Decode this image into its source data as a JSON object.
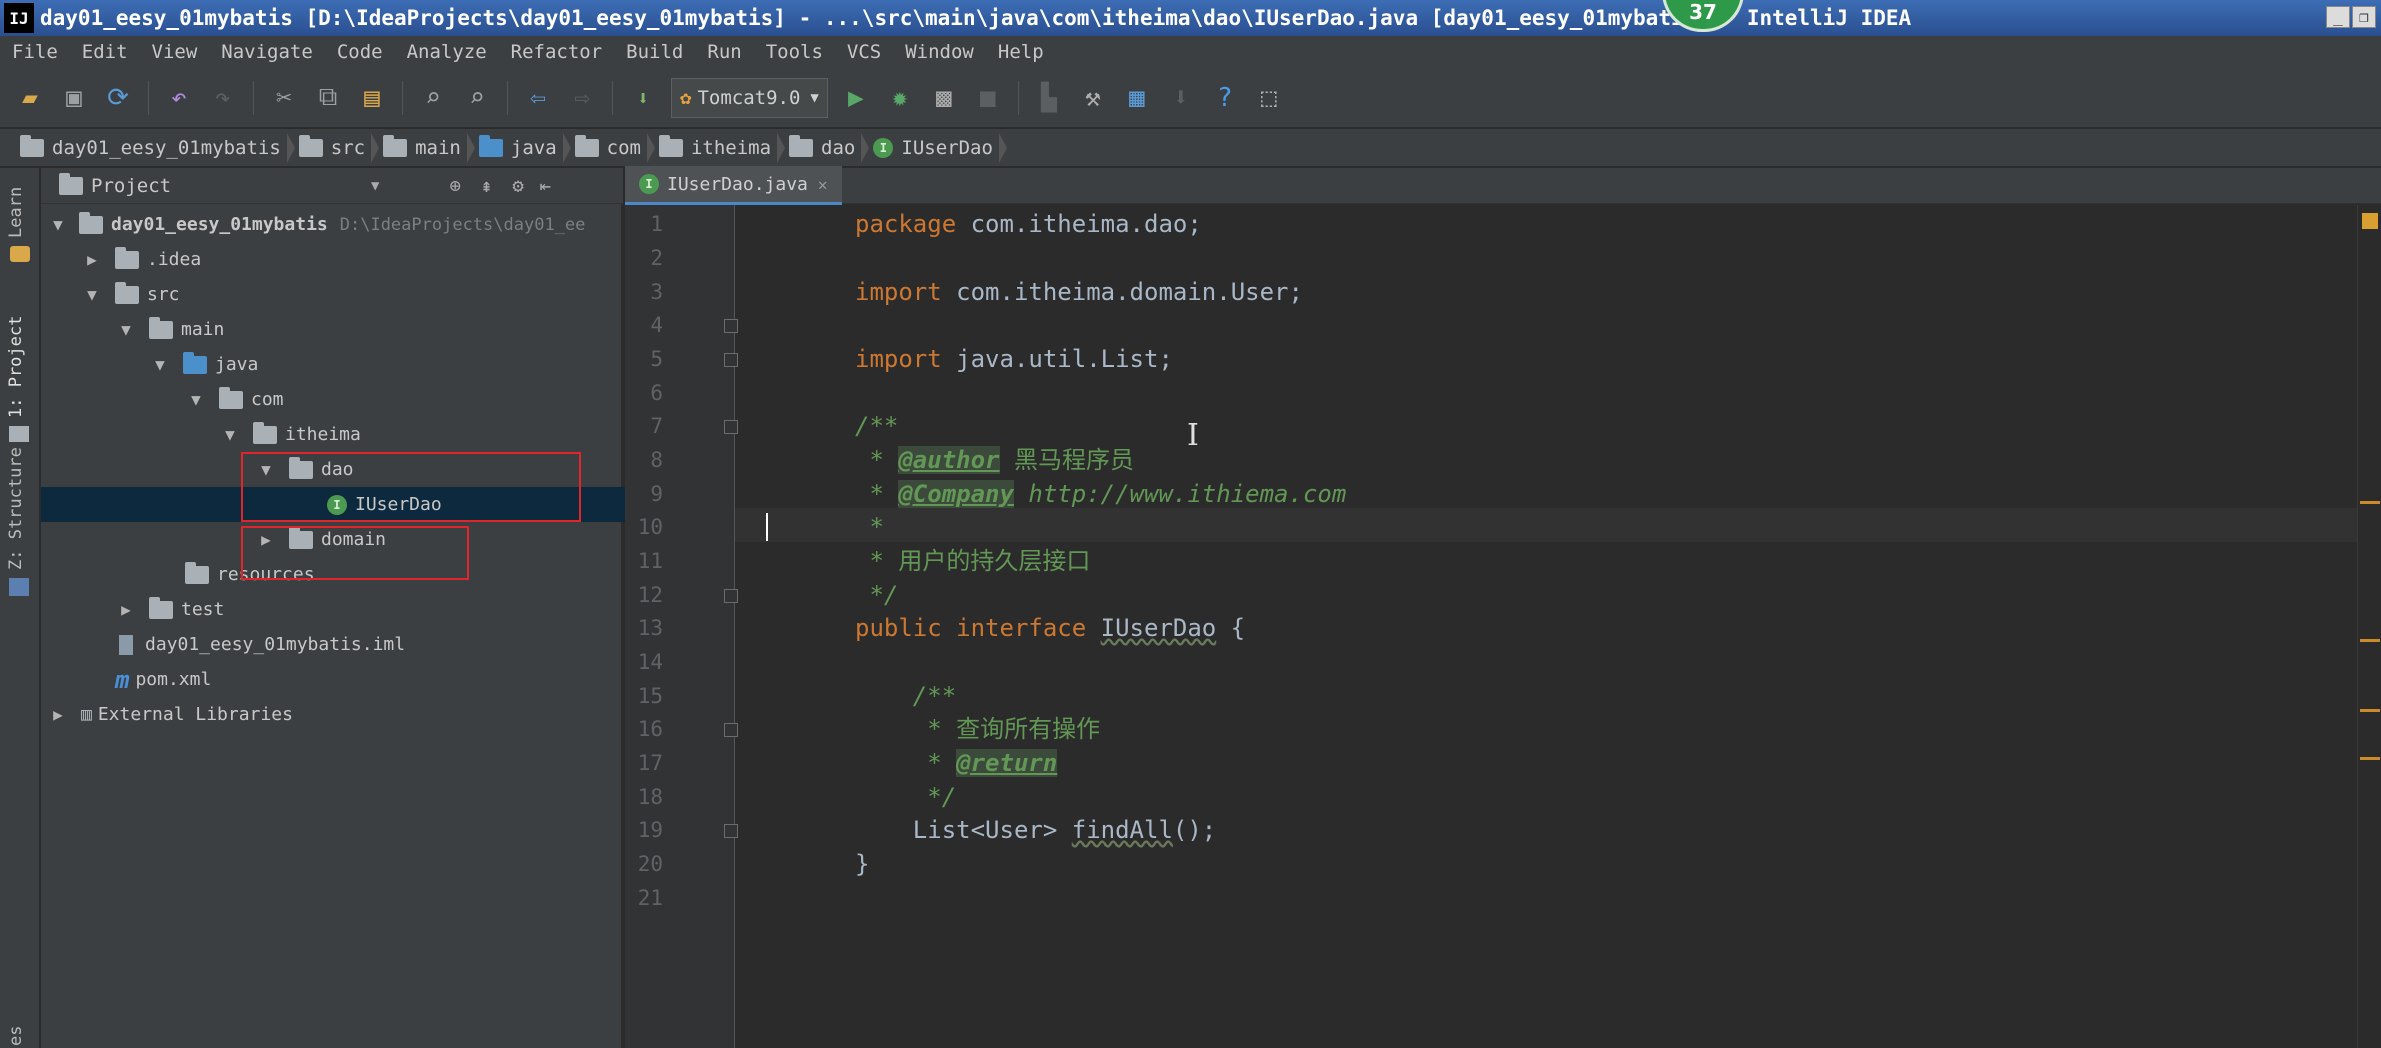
{
  "window": {
    "logo": "IJ",
    "title": "day01_eesy_01mybatis [D:\\IdeaProjects\\day01_eesy_01mybatis] - ...\\src\\main\\java\\com\\itheima\\dao\\IUserDao.java [day01_eesy_01mybatis] - IntelliJ IDEA",
    "badge": "37",
    "minimize_glyph": "_",
    "restore_glyph": "❐"
  },
  "menu": [
    "File",
    "Edit",
    "View",
    "Navigate",
    "Code",
    "Analyze",
    "Refactor",
    "Build",
    "Run",
    "Tools",
    "VCS",
    "Window",
    "Help"
  ],
  "toolbar": {
    "run_config": "Tomcat9.0"
  },
  "breadcrumb": [
    "day01_eesy_01mybatis",
    "src",
    "main",
    "java",
    "com",
    "itheima",
    "dao",
    "IUserDao"
  ],
  "left_stripe": {
    "learn": "Learn",
    "project": "1: Project",
    "structure": "Z: Structure",
    "bottom": "es"
  },
  "project_panel": {
    "title": "Project",
    "tree": [
      {
        "label": "day01_eesy_01mybatis",
        "extra": "D:\\IdeaProjects\\day01_ee",
        "arrow": "▼"
      },
      {
        "label": ".idea",
        "arrow": "▶"
      },
      {
        "label": "src",
        "arrow": "▼"
      },
      {
        "label": "main",
        "arrow": "▼"
      },
      {
        "label": "java",
        "arrow": "▼"
      },
      {
        "label": "com",
        "arrow": "▼"
      },
      {
        "label": "itheima",
        "arrow": "▼"
      },
      {
        "label": "dao",
        "arrow": "▼"
      },
      {
        "label": "IUserDao",
        "arrow": ""
      },
      {
        "label": "domain",
        "arrow": "▶"
      },
      {
        "label": "resources",
        "arrow": ""
      },
      {
        "label": "test",
        "arrow": "▶"
      },
      {
        "label": "day01_eesy_01mybatis.iml",
        "arrow": ""
      },
      {
        "label": "pom.xml",
        "arrow": ""
      },
      {
        "label": "External Libraries",
        "arrow": "▶"
      }
    ]
  },
  "editor": {
    "tab_label": "IUserDao.java",
    "line_numbers": [
      "1",
      "2",
      "3",
      "4",
      "5",
      "6",
      "7",
      "8",
      "9",
      "10",
      "11",
      "12",
      "13",
      "14",
      "15",
      "16",
      "17",
      "18",
      "19",
      "20",
      "21"
    ],
    "code": {
      "l1_kw": "package",
      "l1_rest": " com.itheima.dao;",
      "l3_kw": "import",
      "l3_rest": " com.itheima.domain.User;",
      "l5_kw": "import",
      "l5_rest": " java.util.List;",
      "l7": "/**",
      "l8_pre": " * ",
      "l8_tag": "@author",
      "l8_text": " 黑马程序员",
      "l9_pre": " * ",
      "l9_tag": "@Company",
      "l9_text": " http://www.ithiema.com",
      "l10": " *",
      "l11": " * 用户的持久层接口",
      "l12": " */",
      "l13_kw": "public interface",
      "l13_name": "IUserDao",
      "l13_rest": " {",
      "l15": "    /**",
      "l16": "     * 查询所有操作",
      "l17_pre": "     * ",
      "l17_tag": "@return",
      "l18": "     */",
      "l19_pre": "    List<User> ",
      "l19_fn": "findAll",
      "l19_rest": "();",
      "l20": "}"
    }
  }
}
